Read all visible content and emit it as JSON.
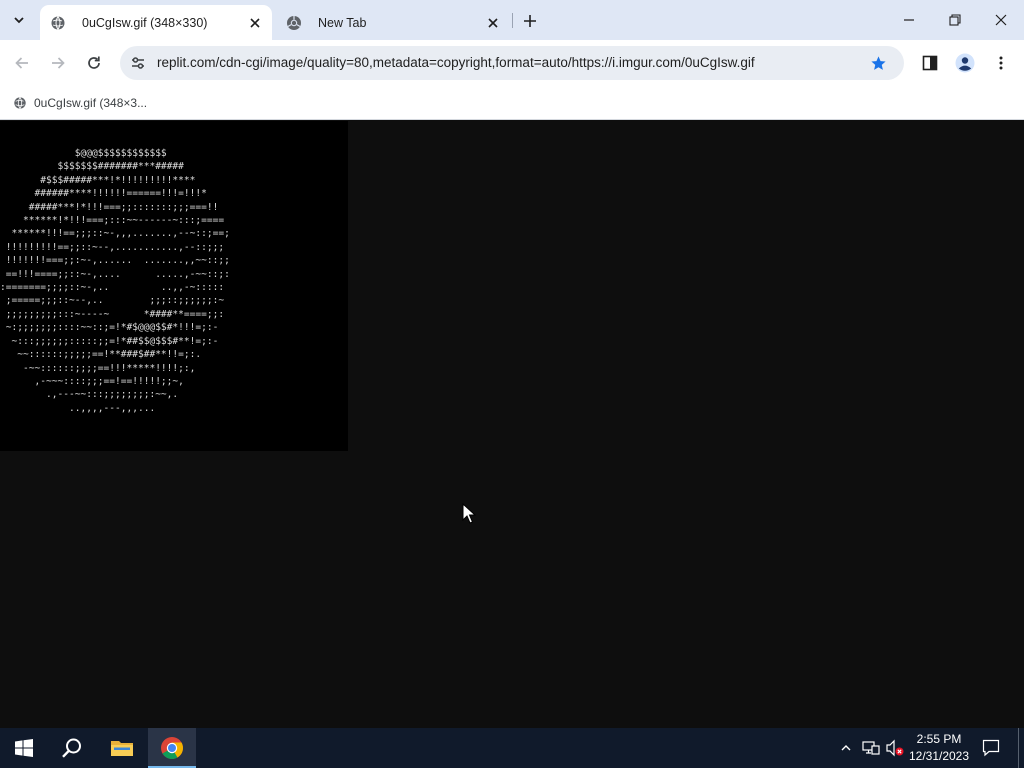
{
  "colors": {
    "tabstrip_bg": "#dfe7f5",
    "page_bg": "#0e0e0e",
    "image_bg": "#000000",
    "ascii_text": "#dcdcdc",
    "bookmark_star": "#1a73e8",
    "taskbar_bg": "#101a2b"
  },
  "tabs": [
    {
      "title": "0uCgIsw.gif (348×330)",
      "active": true,
      "icon": "globe-icon"
    },
    {
      "title": "New Tab",
      "active": false,
      "icon": "chrome-icon"
    }
  ],
  "address_bar": {
    "url": "replit.com/cdn-cgi/image/quality=80,metadata=copyright,format=auto/https://i.imgur.com/0uCgIsw.gif",
    "bookmarked": true
  },
  "bookmarks_bar": {
    "items": [
      {
        "label": "0uCgIsw.gif (348×3...",
        "icon": "globe-icon"
      }
    ]
  },
  "page": {
    "image_alt": "0uCgIsw.gif",
    "ascii_art": "             $@@@$$$$$$$$$$$$\n          $$$$$$$#######***#####\n       #$$$#####***!*!!!!!!!!!****\n      ######****!!!!!!======!!!=!!!*\n     #####***!*!!!===;;:::::::;;;===!!\n    ******!*!!!===;:::~~------~:::;====\n  ******!!!==;;;::~-,,,.......,--~::;==;\n !!!!!!!!!==;;::~--,...........,--::;;;\n !!!!!!!===;;:~-,......  .......,,~~::;;\n ==!!!====;;::~-,....      .....,-~~::;:\n:=======;;;;::~-,..         ..,,-~:::::\n ;=====;;;::~--,..        ;;;::;;;;;;:~\n ;;;;;;;;;:::~----~      *####**====;;:\n ~:;;;;;;;::::~~::;=!*#$@@@$$#*!!!=;:-\n  ~:::;;;;;;:::::;;=!*##$$@$$$#**!=;:-\n   ~~::::::;;;;;==!**###$##**!!=;:.\n    -~~::::::;;;;==!!!*****!!!!;:,\n      ,-~~~::::;;;==!==!!!!!;;~,\n        .,---~~:::;;;;;;;;:~~,.\n            ..,,,,---,,,..."
  },
  "taskbar": {
    "apps": [
      {
        "name": "Start",
        "icon": "windows-start-icon"
      },
      {
        "name": "Search",
        "icon": "search-icon"
      },
      {
        "name": "File Explorer",
        "icon": "folder-icon"
      },
      {
        "name": "Google Chrome",
        "icon": "chrome-icon",
        "active": true
      }
    ],
    "clock_time": "2:55 PM",
    "clock_date": "12/31/2023"
  }
}
